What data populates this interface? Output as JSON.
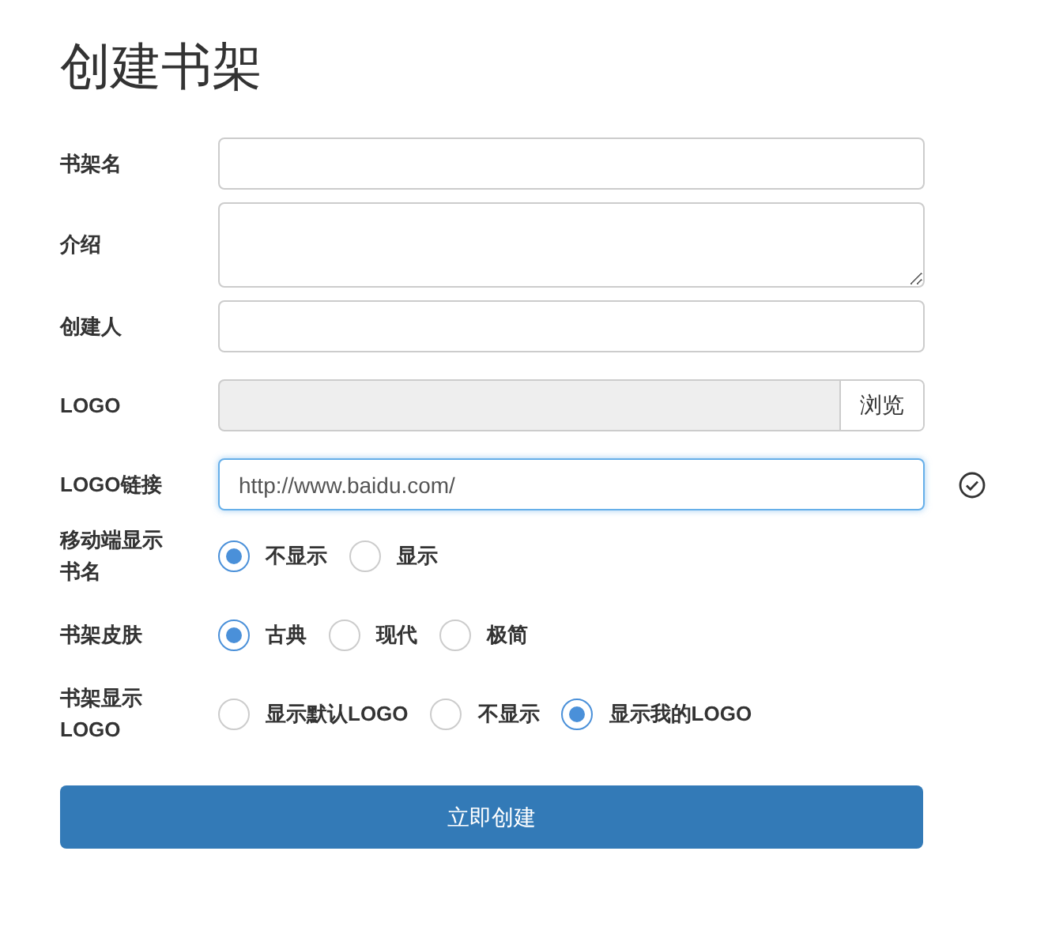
{
  "title": "创建书架",
  "fields": [
    {
      "kind": "text",
      "label": "书架名"
    },
    {
      "kind": "textarea",
      "label": "介绍"
    },
    {
      "kind": "text",
      "label": "创建人"
    },
    {
      "kind": "file",
      "label": "LOGO",
      "button": "浏览"
    },
    {
      "kind": "text",
      "label": "LOGO链接",
      "value": "http://www.baidu.com/",
      "focused": true,
      "valid": true
    },
    {
      "kind": "radio",
      "label": "移动端显示书名",
      "options": [
        {
          "label": "不显示",
          "selected": true
        },
        {
          "label": "显示",
          "selected": false
        }
      ]
    },
    {
      "kind": "radio",
      "label": "书架皮肤",
      "options": [
        {
          "label": "古典",
          "selected": true
        },
        {
          "label": "现代",
          "selected": false
        },
        {
          "label": "极简",
          "selected": false
        }
      ]
    },
    {
      "kind": "radio",
      "label": "书架显示LOGO",
      "options": [
        {
          "label": "显示默认LOGO",
          "selected": false
        },
        {
          "label": "不显示",
          "selected": false
        },
        {
          "label": "显示我的LOGO",
          "selected": true
        }
      ]
    }
  ],
  "submit": "立即创建"
}
